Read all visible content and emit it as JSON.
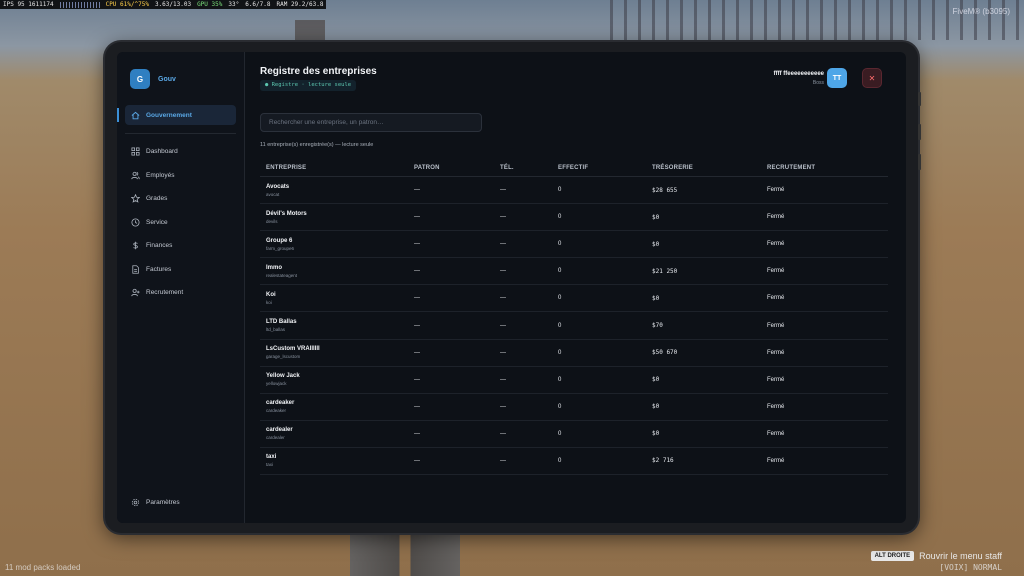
{
  "hud": {
    "perf_text": "IPS 95  1611174",
    "cpu_text": "CPU 61%/^75%",
    "cpu_freq": "3.63/13.03",
    "gpu_text": "GPU 35%",
    "gpu_temp": "33°",
    "mem_text": "6.6/7.8",
    "ram_text": "RAM 29.2/63.8",
    "server_tag": "FiveM® (b3095)",
    "mods_text": "11 mod packs loaded",
    "staff_key": "ALT DROITE",
    "staff_text": "Rouvrir le menu staff",
    "voice_text": "[VOIX] NORMAL"
  },
  "sidebar": {
    "logo_letter": "G",
    "brand": "Gouv",
    "active_item": {
      "label": "Gouvernement",
      "icon": "home-icon"
    },
    "items": [
      {
        "label": "Dashboard",
        "icon": "grid-icon"
      },
      {
        "label": "Employés",
        "icon": "users-icon"
      },
      {
        "label": "Grades",
        "icon": "star-icon"
      },
      {
        "label": "Service",
        "icon": "clock-icon"
      },
      {
        "label": "Finances",
        "icon": "dollar-icon"
      },
      {
        "label": "Factures",
        "icon": "document-icon"
      },
      {
        "label": "Recrutement",
        "icon": "user-plus-icon"
      }
    ],
    "footer": {
      "label": "Paramètres",
      "icon": "gear-icon"
    }
  },
  "header": {
    "title": "Registre des entreprises",
    "chip": "● Registre · lecture seule",
    "user_name": "ffff ffeeeeeeeeeee",
    "user_role": "Boss",
    "avatar": "TT",
    "close_symbol": "✕"
  },
  "search": {
    "placeholder": "Rechercher une entreprise, un patron…",
    "value": ""
  },
  "count_text": "11 entreprise(s) enregistrée(s) — lecture seule",
  "table": {
    "columns": [
      "ENTREPRISE",
      "PATRON",
      "TÉL.",
      "EFFECTIF",
      "TRÉSORERIE",
      "RECRUTEMENT"
    ],
    "rows": [
      {
        "name": "Avocats",
        "id": "avocat",
        "boss": "—",
        "tel": "—",
        "staff": "0",
        "treasury": "$28 655",
        "recruit": "Fermé"
      },
      {
        "name": "Dévil's Motors",
        "id": "devils",
        "boss": "—",
        "tel": "—",
        "staff": "0",
        "treasury": "$0",
        "recruit": "Fermé"
      },
      {
        "name": "Groupe 6",
        "id": "farm_groupe6",
        "boss": "—",
        "tel": "—",
        "staff": "0",
        "treasury": "$0",
        "recruit": "Fermé"
      },
      {
        "name": "Immo",
        "id": "realestateagent",
        "boss": "—",
        "tel": "—",
        "staff": "0",
        "treasury": "$21 250",
        "recruit": "Fermé"
      },
      {
        "name": "Koi",
        "id": "koi",
        "boss": "—",
        "tel": "—",
        "staff": "0",
        "treasury": "$0",
        "recruit": "Fermé"
      },
      {
        "name": "LTD Ballas",
        "id": "ltd_ballas",
        "boss": "—",
        "tel": "—",
        "staff": "0",
        "treasury": "$70",
        "recruit": "Fermé"
      },
      {
        "name": "LsCustom VRAIIIIII",
        "id": "garage_lscustom",
        "boss": "—",
        "tel": "—",
        "staff": "0",
        "treasury": "$50 670",
        "recruit": "Fermé"
      },
      {
        "name": "Yellow Jack",
        "id": "yellowjack",
        "boss": "—",
        "tel": "—",
        "staff": "0",
        "treasury": "$0",
        "recruit": "Fermé"
      },
      {
        "name": "cardeaker",
        "id": "cardeaker",
        "boss": "—",
        "tel": "—",
        "staff": "0",
        "treasury": "$0",
        "recruit": "Fermé"
      },
      {
        "name": "cardealer",
        "id": "cardealer",
        "boss": "—",
        "tel": "—",
        "staff": "0",
        "treasury": "$0",
        "recruit": "Fermé"
      },
      {
        "name": "taxi",
        "id": "taxi",
        "boss": "—",
        "tel": "—",
        "staff": "0",
        "treasury": "$2 716",
        "recruit": "Fermé"
      }
    ]
  }
}
